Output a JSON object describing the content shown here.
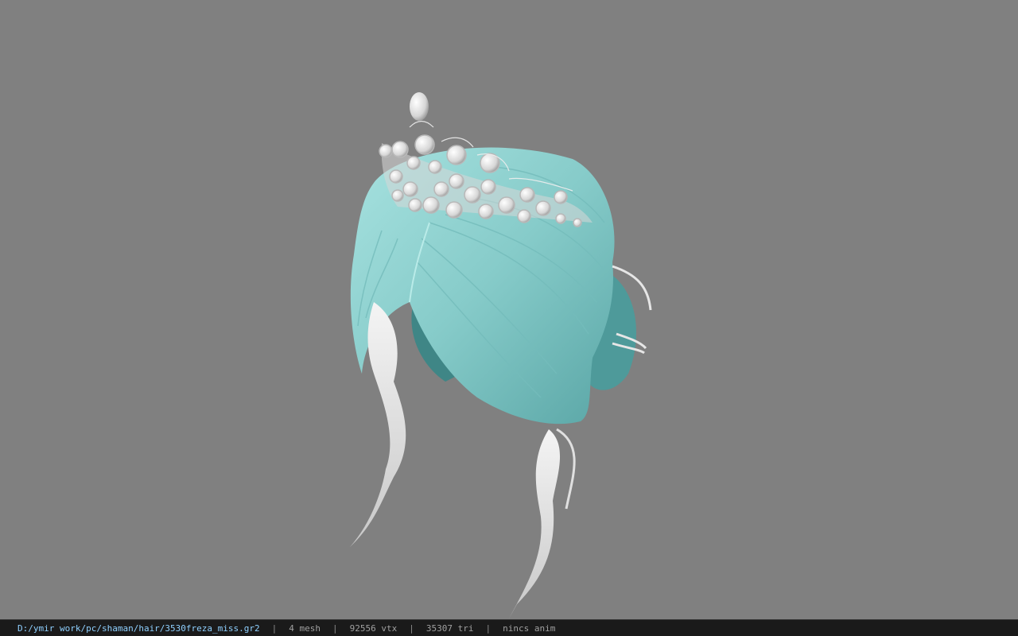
{
  "viewer": {
    "background_color": "#808080",
    "hair_color": "#8fd3d0",
    "accent_color": "#e8e8e8",
    "model_icon": "hair-model-tiara"
  },
  "statusbar": {
    "file_path": "D:/ymir work/pc/shaman/hair/3530freza_miss.gr2",
    "separator": "|",
    "mesh_count": "4 mesh",
    "vertex_count": "92556 vtx",
    "triangle_count": "35307 tri",
    "anim_status": "nincs anim"
  }
}
